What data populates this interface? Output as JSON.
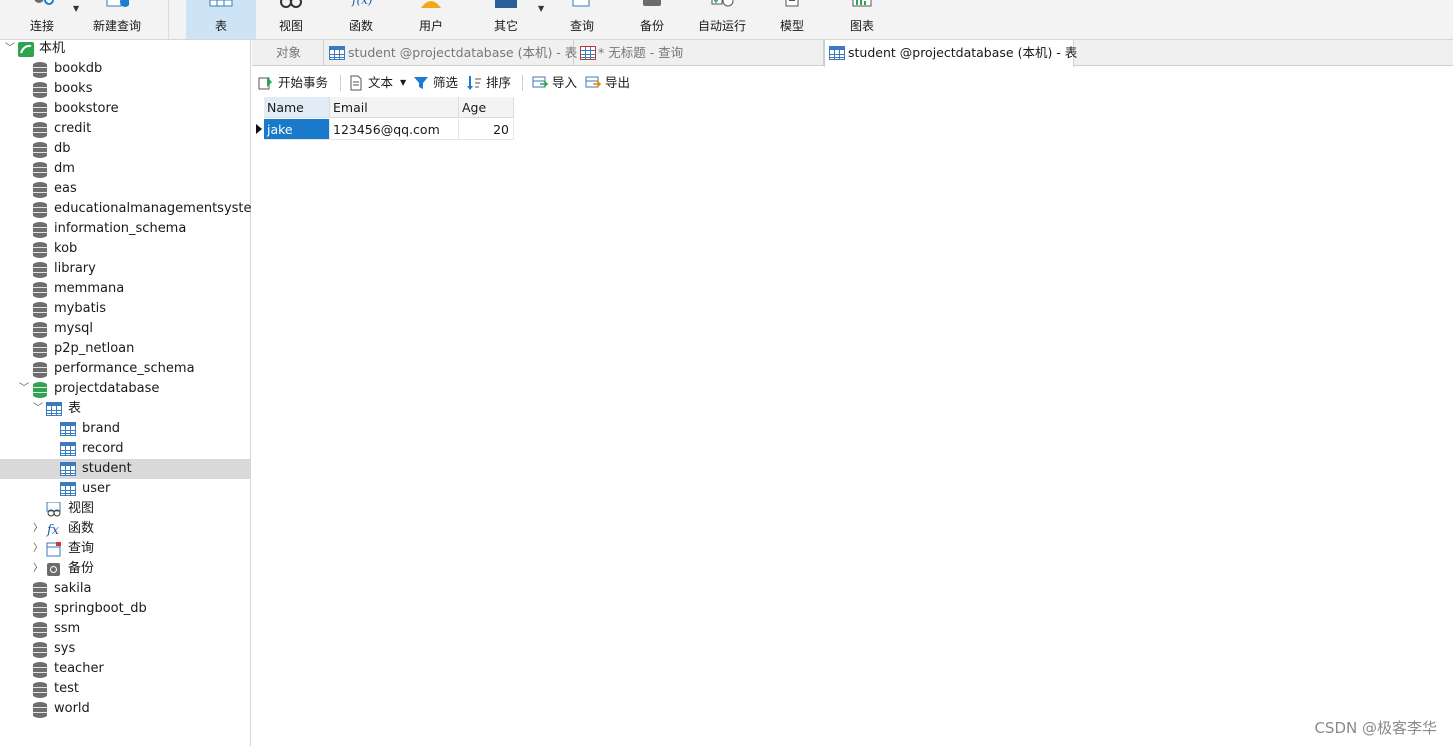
{
  "toolbar": {
    "items": [
      {
        "label": "连接",
        "icon": "connection-icon"
      },
      {
        "label": "新建查询",
        "icon": "new-query-icon"
      },
      {
        "label": "表",
        "icon": "table-icon",
        "active": true
      },
      {
        "label": "视图",
        "icon": "view-icon"
      },
      {
        "label": "函数",
        "icon": "function-icon"
      },
      {
        "label": "用户",
        "icon": "user-icon"
      },
      {
        "label": "其它",
        "icon": "other-icon"
      },
      {
        "label": "查询",
        "icon": "query-icon"
      },
      {
        "label": "备份",
        "icon": "backup-icon"
      },
      {
        "label": "自动运行",
        "icon": "auto-run-icon"
      },
      {
        "label": "模型",
        "icon": "model-icon"
      },
      {
        "label": "图表",
        "icon": "chart-icon"
      }
    ]
  },
  "tree": {
    "root": "本机",
    "databases": [
      "bookdb",
      "books",
      "bookstore",
      "credit",
      "db",
      "dm",
      "eas",
      "educationalmanagementsystem",
      "information_schema",
      "kob",
      "library",
      "memmana",
      "mybatis",
      "mysql",
      "p2p_netloan",
      "performance_schema"
    ],
    "open_db": "projectdatabase",
    "tables_folder": "表",
    "tables": [
      "brand",
      "record",
      "student",
      "user"
    ],
    "selected_table": "student",
    "subfolders": [
      "视图",
      "函数",
      "查询",
      "备份"
    ],
    "databases_after": [
      "sakila",
      "springboot_db",
      "ssm",
      "sys",
      "teacher",
      "test",
      "world"
    ]
  },
  "tabs": {
    "objects": "对象",
    "tab1": "student @projectdatabase (本机) - 表",
    "tab2": "* 无标题 - 查询",
    "tab3": "student @projectdatabase (本机) - 表"
  },
  "table_toolbar": {
    "begin_transaction": "开始事务",
    "text": "文本",
    "filter": "筛选",
    "sort": "排序",
    "import": "导入",
    "export": "导出"
  },
  "grid": {
    "columns": [
      "Name",
      "Email",
      "Age"
    ],
    "rows": [
      [
        "jake",
        "123456@qq.com",
        "20"
      ]
    ]
  },
  "watermark": "CSDN @极客李华"
}
